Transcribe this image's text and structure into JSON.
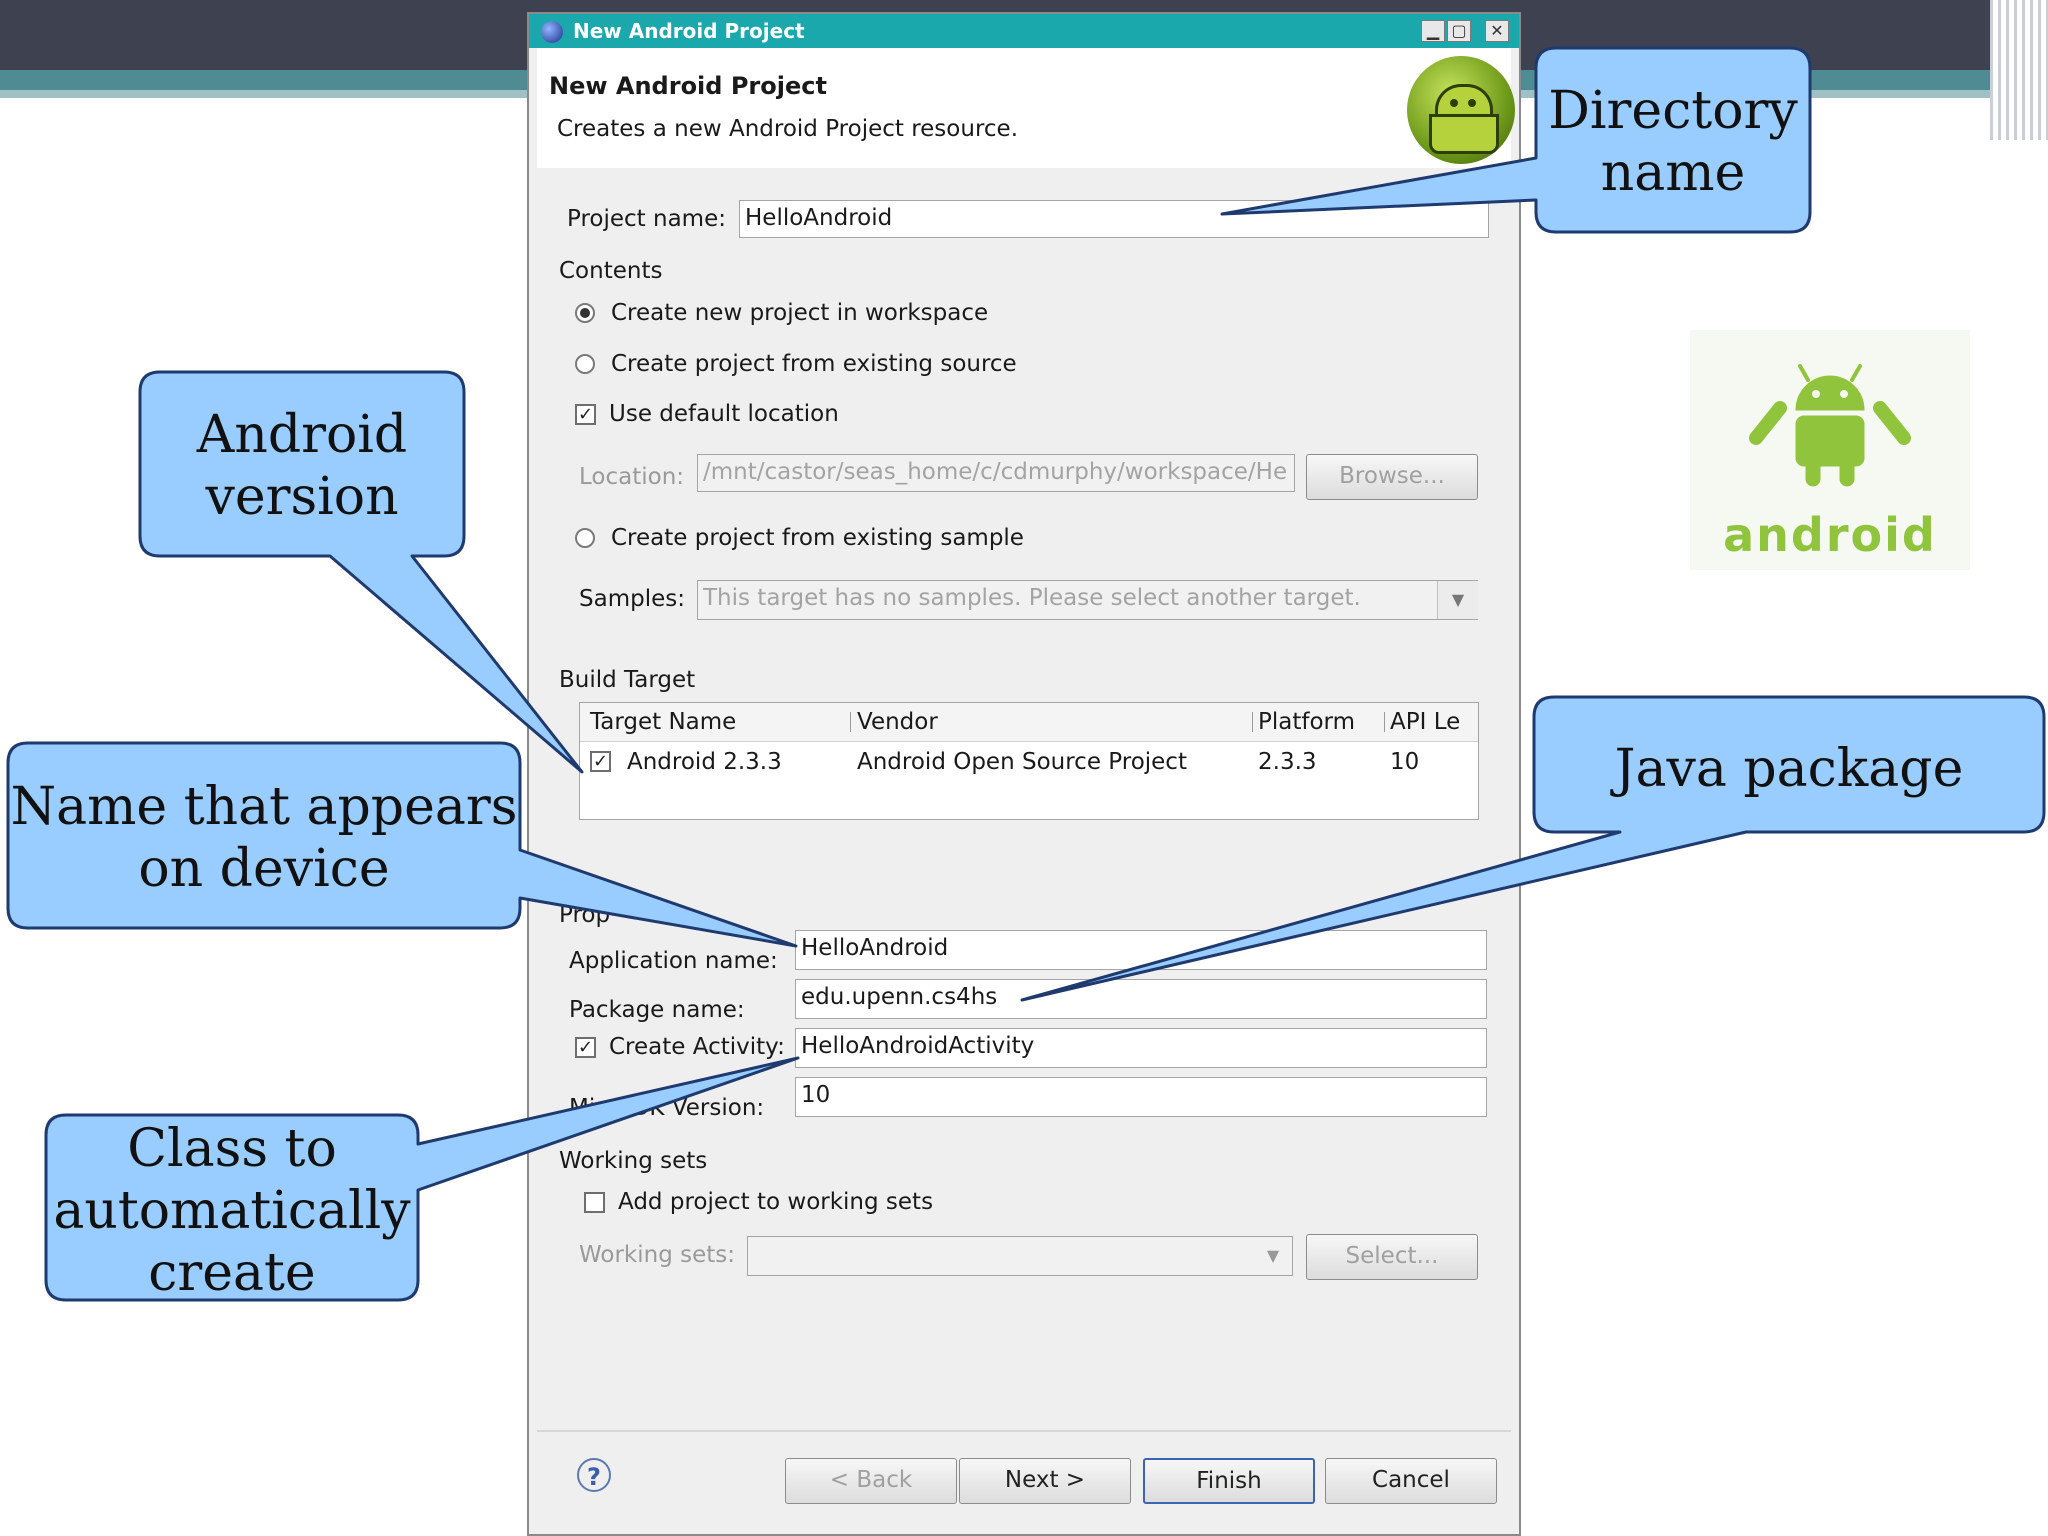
{
  "dialog": {
    "window_title": "New Android Project",
    "header_title": "New Android Project",
    "header_subtitle": "Creates a new Android Project resource.",
    "title_buttons": [
      "▁",
      "▢",
      "✕"
    ]
  },
  "form": {
    "project_name_label": "Project name:",
    "project_name_value": "HelloAndroid",
    "contents_label": "Contents",
    "radio_new": "Create new project in workspace",
    "radio_existing": "Create project from existing source",
    "use_default_location": "Use default location",
    "location_label": "Location:",
    "location_value": "/mnt/castor/seas_home/c/cdmurphy/workspace/He",
    "browse_button": "Browse...",
    "radio_sample": "Create project from existing sample",
    "samples_label": "Samples:",
    "samples_value": "This target has no samples. Please select another target.",
    "build_target_label": "Build Target",
    "table": {
      "headers": [
        "Target Name",
        "Vendor",
        "Platform",
        "API Le"
      ],
      "rows": [
        [
          "Android 2.3.3",
          "Android Open Source Project",
          "2.3.3",
          "10"
        ]
      ]
    },
    "properties_label": "Prop",
    "app_name_label": "Application name:",
    "app_name_value": "HelloAndroid",
    "package_label": "Package name:",
    "package_value": "edu.upenn.cs4hs",
    "create_activity_label": "Create Activity:",
    "create_activity_value": "HelloAndroidActivity",
    "min_sdk_label": "Min SDK Version:",
    "min_sdk_value": "10",
    "working_sets_label": "Working sets",
    "add_to_working_sets": "Add project to working sets",
    "working_sets_field_label": "Working sets:",
    "select_button": "Select..."
  },
  "footer": {
    "help": "?",
    "back": "< Back",
    "next": "Next >",
    "finish": "Finish",
    "cancel": "Cancel"
  },
  "callouts": {
    "directory_1": "Directory",
    "directory_2": "name",
    "android_1": "Android",
    "android_2": "version",
    "device_1": "Name that appears",
    "device_2": "on device",
    "java": "Java package",
    "class_1": "Class to",
    "class_2": "automatically",
    "class_3": "create"
  },
  "brand": {
    "wordmark": "android"
  },
  "colors": {
    "callout_fill": "#99ccff",
    "callout_stroke": "#1f3a6e",
    "titlebar": "#1aa8ac",
    "android_green": "#8fc43c"
  }
}
